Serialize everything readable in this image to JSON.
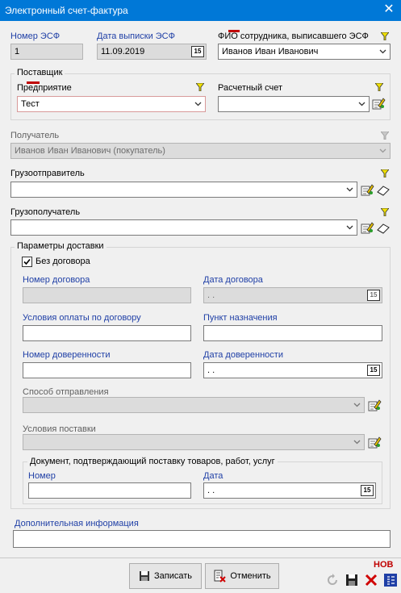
{
  "window": {
    "title": "Электронный счет-фактура",
    "close_glyph": "✕"
  },
  "header": {
    "esf_number_label": "Номер ЭСФ",
    "esf_number_value": "1",
    "issue_date_label": "Дата выписки ЭСФ",
    "issue_date_value": "11.09.2019",
    "employee_label": "ФИО сотрудника, выписавшего ЭСФ",
    "employee_value": "Иванов Иван Иванович"
  },
  "supplier": {
    "group_label": "Поставщик",
    "enterprise_label": "Предприятие",
    "enterprise_value": "Тест",
    "account_label": "Расчетный счет",
    "account_value": ""
  },
  "recipient": {
    "label": "Получатель",
    "value": "Иванов Иван Иванович (покупатель)"
  },
  "shipper": {
    "label": "Грузоотправитель",
    "value": ""
  },
  "consignee": {
    "label": "Грузополучатель",
    "value": ""
  },
  "delivery": {
    "group_label": "Параметры доставки",
    "no_contract_label": "Без договора",
    "no_contract_checked": true,
    "contract_number_label": "Номер договора",
    "contract_number_value": "",
    "contract_date_label": "Дата договора",
    "contract_date_value": ". .",
    "payment_terms_label": "Условия оплаты по договору",
    "payment_terms_value": "",
    "destination_label": "Пункт назначения",
    "destination_value": "",
    "poa_number_label": "Номер доверенности",
    "poa_number_value": "",
    "poa_date_label": "Дата доверенности",
    "poa_date_value": ". .",
    "dispatch_method_label": "Способ отправления",
    "dispatch_method_value": "",
    "delivery_terms_label": "Условия поставки",
    "delivery_terms_value": ""
  },
  "supporting_doc": {
    "group_label": "Документ, подтверждающий поставку товаров, работ, услуг",
    "number_label": "Номер",
    "number_value": "",
    "date_label": "Дата",
    "date_value": ". ."
  },
  "additional": {
    "label": "Дополнительная информация",
    "value": ""
  },
  "footer": {
    "save_label": "Записать",
    "cancel_label": "Отменить",
    "status_badge": "НОВ",
    "calendar_glyph": "15"
  },
  "colors": {
    "title_bar": "#0078d7",
    "label_blue": "#1f3fa6",
    "filter_yellow": "#f0e000",
    "required_mark": "#c00000"
  }
}
